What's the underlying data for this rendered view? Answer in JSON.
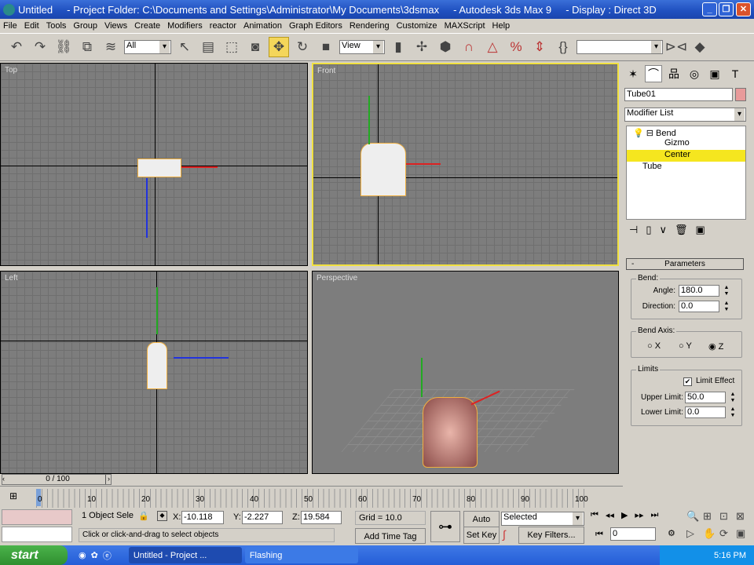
{
  "window": {
    "title": "Untitled     - Project Folder: C:\\Documents and Settings\\Administrator\\My Documents\\3dsmax     - Autodesk 3ds Max 9     - Display : Direct 3D"
  },
  "menu": [
    "File",
    "Edit",
    "Tools",
    "Group",
    "Views",
    "Create",
    "Modifiers",
    "reactor",
    "Animation",
    "Graph Editors",
    "Rendering",
    "Customize",
    "MAXScript",
    "Help"
  ],
  "toolbar": {
    "selection_filter": "All",
    "ref_coord": "View",
    "named_selection": ""
  },
  "viewports": {
    "top": "Top",
    "front": "Front",
    "left": "Left",
    "perspective": "Perspective"
  },
  "command_panel": {
    "object_name": "Tube01",
    "object_color": "#e89a9a",
    "modifier_list": "Modifier List",
    "stack": [
      {
        "label": "Bend"
      },
      {
        "label": "Gizmo"
      },
      {
        "label": "Center"
      },
      {
        "label": "Tube"
      }
    ],
    "rollout_title": "Parameters",
    "bend": {
      "title": "Bend:",
      "angle_label": "Angle:",
      "angle": "180.0",
      "direction_label": "Direction:",
      "direction": "0.0"
    },
    "bend_axis": {
      "title": "Bend Axis:",
      "options": [
        "X",
        "Y",
        "Z"
      ],
      "selected": "Z"
    },
    "limits": {
      "title": "Limits",
      "limit_effect_label": "Limit Effect",
      "limit_effect": true,
      "upper_label": "Upper Limit:",
      "upper": "50.0",
      "lower_label": "Lower Limit:",
      "lower": "0.0"
    }
  },
  "timeline": {
    "slider": "0 / 100",
    "ticks": [
      "0",
      "10",
      "20",
      "30",
      "40",
      "50",
      "60",
      "70",
      "80",
      "90",
      "100"
    ]
  },
  "status": {
    "selection": "1 Object Sele",
    "x_label": "X:",
    "x": "-10.118",
    "y_label": "Y:",
    "y": "-2.227",
    "z_label": "Z:",
    "z": "19.584",
    "grid": "Grid = 10.0",
    "prompt": "Click or click-and-drag to select objects",
    "add_time_tag": "Add Time Tag",
    "auto_key": "Auto Key",
    "set_key": "Set Key",
    "key_mode": "Selected",
    "key_filters": "Key Filters...",
    "frame": "0"
  },
  "taskbar": {
    "start": "start",
    "tasks": [
      "Untitled     - Project ...",
      "Flashing"
    ],
    "clock": "5:16 PM"
  }
}
